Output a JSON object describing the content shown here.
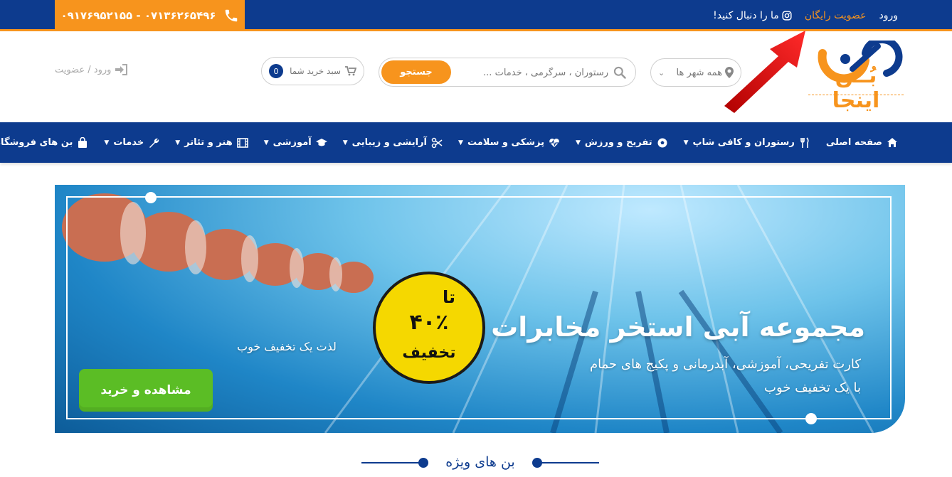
{
  "topbar": {
    "phones": "۰۹۱۷۶۹۵۲۱۵۵ - ۰۷۱۳۶۲۶۵۴۹۶",
    "login": "ورود",
    "free_signup": "عضویت رایگان",
    "follow": "ما را دنبال کنید!"
  },
  "header": {
    "logo_text": "بُــن اینجا",
    "city_select": "همه شهر ها",
    "search_placeholder": "رستوران ، سرگرمی ، خدمات ...",
    "search_button": "جستجو",
    "cart_label": "سبد خرید شما",
    "cart_count": "0",
    "login_signup": "ورود / عضویت"
  },
  "nav": {
    "items": [
      {
        "label": "صفحه اصلی",
        "icon": "home-icon",
        "dropdown": false
      },
      {
        "label": "رستوران و کافی شاپ",
        "icon": "cutlery-icon",
        "dropdown": true
      },
      {
        "label": "تفریح و ورزش",
        "icon": "soccer-ball-icon",
        "dropdown": true
      },
      {
        "label": "پزشکی و سلامت",
        "icon": "heartbeat-icon",
        "dropdown": true
      },
      {
        "label": "آرایشی و زیبایی",
        "icon": "scissors-icon",
        "dropdown": true
      },
      {
        "label": "آموزشی",
        "icon": "graduation-cap-icon",
        "dropdown": true
      },
      {
        "label": "هنر و تئاتر",
        "icon": "film-icon",
        "dropdown": true
      },
      {
        "label": "خدمات",
        "icon": "wrench-icon",
        "dropdown": true
      },
      {
        "label": "بن های فروشگاهی",
        "icon": "shopping-bag-icon",
        "dropdown": true
      }
    ]
  },
  "banner": {
    "headline": "مجموعه آبی استخر مخابرات",
    "subline_1": "کارت تفریحی، آموزشی، آبدرمانی و پکیج های حمام",
    "subline_2": "با یک تخفیف خوب",
    "tagline": "لذت یک تخفیف خوب",
    "badge_top": "تا",
    "badge_value": "۴۰٪",
    "badge_bottom": "تخفیف",
    "cta": "مشاهده و خرید"
  },
  "section": {
    "title": "بن های ویژه"
  },
  "colors": {
    "brand_blue": "#0d3b8e",
    "brand_orange": "#f7941d",
    "cta_green": "#5bbd25",
    "badge_yellow": "#f5d800"
  }
}
